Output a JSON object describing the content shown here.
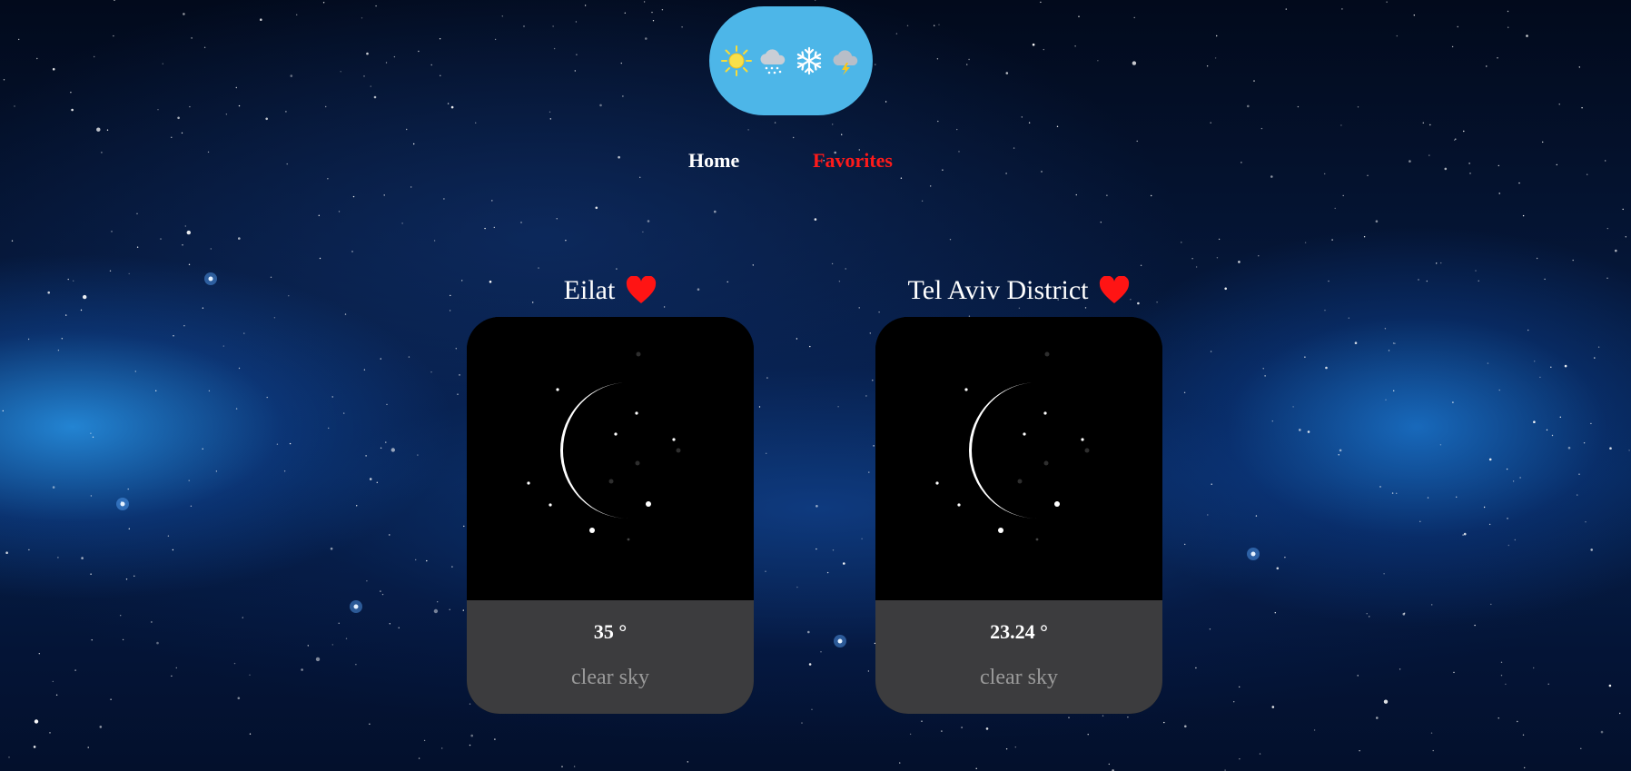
{
  "nav": {
    "home_label": "Home",
    "favorites_label": "Favorites",
    "active_color": "#ff1a1a"
  },
  "logo": {
    "background": "#4db6e8",
    "icons": [
      "sun-icon",
      "rain-cloud-icon",
      "snowflake-icon",
      "thunder-cloud-icon"
    ]
  },
  "favorites": [
    {
      "city": "Eilat",
      "temperature": "35 °",
      "description": "clear sky",
      "icon": "crescent-moon-night-icon",
      "is_favorite": true
    },
    {
      "city": "Tel Aviv District",
      "temperature": "23.24 °",
      "description": "clear sky",
      "icon": "crescent-moon-night-icon",
      "is_favorite": true
    }
  ],
  "colors": {
    "heart": "#ff1414",
    "card_info_bg": "#3c3c3e",
    "description_text": "#9a9a9a"
  }
}
